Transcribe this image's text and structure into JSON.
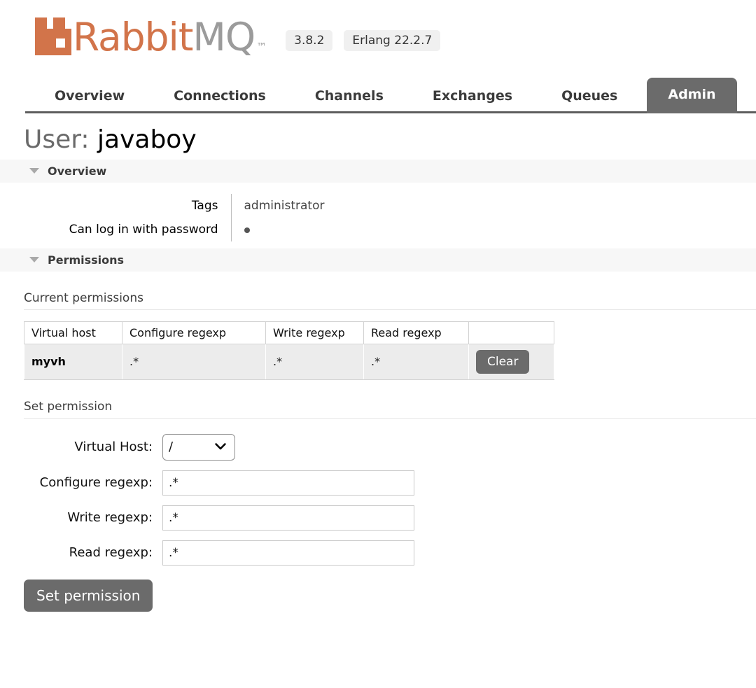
{
  "header": {
    "logo_rabbit": "Rabbit",
    "logo_mq": "MQ",
    "logo_tm": "™",
    "version_badge": "3.8.2",
    "erlang_badge": "Erlang 22.2.7"
  },
  "nav": {
    "tabs": [
      {
        "label": "Overview",
        "active": false
      },
      {
        "label": "Connections",
        "active": false
      },
      {
        "label": "Channels",
        "active": false
      },
      {
        "label": "Exchanges",
        "active": false
      },
      {
        "label": "Queues",
        "active": false
      },
      {
        "label": "Admin",
        "active": true
      }
    ]
  },
  "page": {
    "title_label": "User:",
    "title_value": "javaboy"
  },
  "overview": {
    "section_title": "Overview",
    "rows": [
      {
        "key": "Tags",
        "value": "administrator",
        "is_dot": false
      },
      {
        "key": "Can log in with password",
        "value": "●",
        "is_dot": true
      }
    ]
  },
  "permissions": {
    "section_title": "Permissions",
    "current_heading": "Current permissions",
    "table": {
      "headers": [
        "Virtual host",
        "Configure regexp",
        "Write regexp",
        "Read regexp",
        ""
      ],
      "rows": [
        {
          "virtual_host": "myvh",
          "configure_regexp": ".*",
          "write_regexp": ".*",
          "read_regexp": ".*",
          "action_label": "Clear"
        }
      ]
    },
    "set_heading": "Set permission",
    "form": {
      "vhost_label": "Virtual Host:",
      "vhost_value": "/",
      "vhost_options": [
        "/"
      ],
      "configure_label": "Configure regexp:",
      "configure_value": ".*",
      "write_label": "Write regexp:",
      "write_value": ".*",
      "read_label": "Read regexp:",
      "read_value": ".*",
      "submit_label": "Set permission"
    }
  },
  "colors": {
    "brand_orange": "#d2744a",
    "logo_gray": "#9b9b9b",
    "tab_active_bg": "#6b6b6b",
    "section_bg": "#f7f7f7",
    "button_bg": "#6b6b6b"
  }
}
